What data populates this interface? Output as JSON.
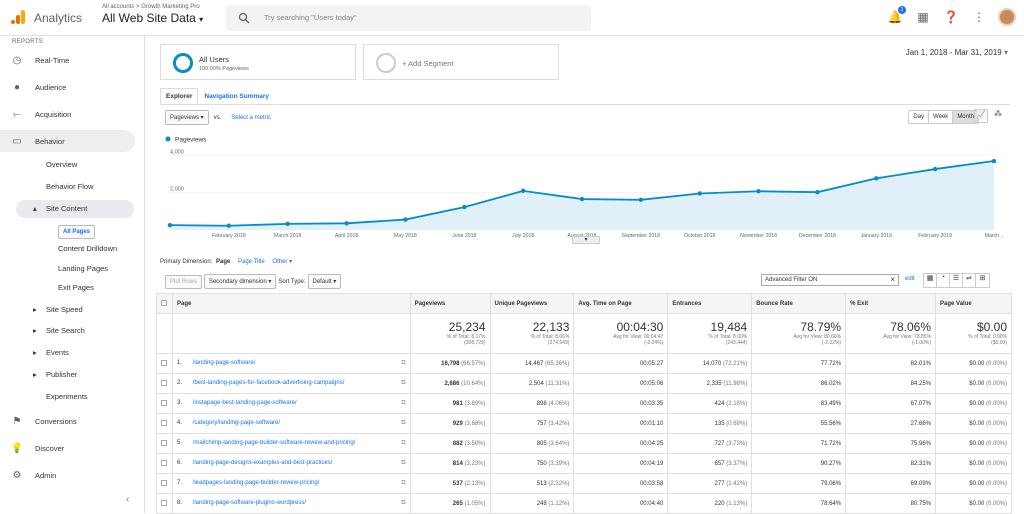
{
  "header": {
    "app_name": "Analytics",
    "breadcrumb": "All accounts > Growth Marketing Pro",
    "property": "All Web Site Data",
    "search_placeholder": "Try searching \"Users today\"",
    "notification_count": "1"
  },
  "sidebar": {
    "section_label": "REPORTS",
    "items": [
      {
        "label": "Real-Time",
        "icon": "clock-icon"
      },
      {
        "label": "Audience",
        "icon": "person-icon"
      },
      {
        "label": "Acquisition",
        "icon": "acquisition-icon"
      },
      {
        "label": "Behavior",
        "icon": "behavior-icon"
      }
    ],
    "behavior_subitems": [
      "Overview",
      "Behavior Flow"
    ],
    "site_content": {
      "label": "Site Content",
      "children": [
        "All Pages",
        "Content Drilldown",
        "Landing Pages",
        "Exit Pages"
      ]
    },
    "more_subitems": [
      "Site Speed",
      "Site Search",
      "Events",
      "Publisher"
    ],
    "experiments": "Experiments",
    "bottom_items": [
      {
        "label": "Conversions",
        "icon": "flag-icon"
      },
      {
        "label": "Discover",
        "icon": "lightbulb-icon"
      },
      {
        "label": "Admin",
        "icon": "gear-icon"
      }
    ]
  },
  "segments": {
    "all_users_label": "All Users",
    "all_users_pct": "100.00% Pageviews",
    "add_segment": "+ Add Segment"
  },
  "date_range": "Jan 1, 2018 - Mar 31, 2019",
  "tabs": [
    "Explorer",
    "Navigation Summary"
  ],
  "controls": {
    "metric": "Pageviews",
    "vs": "vs.",
    "select_metric": "Select a metric",
    "period_buttons": [
      "Day",
      "Week",
      "Month"
    ],
    "active_period": "Month"
  },
  "chart_data": {
    "type": "line",
    "series": [
      {
        "name": "Pageviews",
        "values": [
          260,
          230,
          330,
          360,
          560,
          1230,
          2100,
          1660,
          1620,
          1960,
          2080,
          2030,
          2770,
          3270,
          3700
        ]
      }
    ],
    "categories": [
      "",
      "February 2018",
      "March 2018",
      "April 2018",
      "May 2018",
      "June 2018",
      "July 2018",
      "August 2018",
      "September 2018",
      "October 2018",
      "November 2018",
      "December 2018",
      "January 2019",
      "February 2019",
      "March..."
    ],
    "y_ticks": [
      "4,000",
      "2,000"
    ],
    "ylim": [
      0,
      4400
    ],
    "color": "#058dc7",
    "fill": "#e1f0f8"
  },
  "dimension": {
    "label": "Primary Dimension:",
    "options": [
      "Page",
      "Page Title",
      "Other"
    ]
  },
  "toolbar": {
    "plot_rows": "Plot Rows",
    "secondary_dimension": "Secondary dimension",
    "sort_type_label": "Sort Type:",
    "sort_type": "Default",
    "filter": "Advanced Filter ON",
    "edit": "edit"
  },
  "table": {
    "headers": [
      "Page",
      "Pageviews",
      "Unique Pageviews",
      "Avg. Time on Page",
      "Entrances",
      "Bounce Rate",
      "% Exit",
      "Page Value"
    ],
    "totals": [
      {
        "big": "25,234",
        "small1": "% of Total: 8.17%",
        "small2": "(308,729)"
      },
      {
        "big": "22,133",
        "small1": "% of Total: 8.06%",
        "small2": "(274,549)"
      },
      {
        "big": "00:04:30",
        "small1": "Avg for View: 00:04:47",
        "small2": "(-6.24%)"
      },
      {
        "big": "19,484",
        "small1": "% of Total: 8.00%",
        "small2": "(243,444)"
      },
      {
        "big": "78.79%",
        "small1": "Avg for View: 80.66%",
        "small2": "(-2.32%)"
      },
      {
        "big": "78.06%",
        "small1": "Avg for View: 78.85%",
        "small2": "(-1.00%)"
      },
      {
        "big": "$0.00",
        "small1": "% of Total: 0.00%",
        "small2": "($0.00)"
      }
    ],
    "rows": [
      {
        "n": "1.",
        "page": "/landing-page-software/",
        "pv": "16,798",
        "pvp": "(66.57%)",
        "upv": "14,467",
        "upvp": "(65.36%)",
        "time": "00:05:27",
        "ent": "14,070",
        "entp": "(72.21%)",
        "br": "77.72%",
        "exit": "82.01%",
        "val": "$0.00",
        "valp": "(0.00%)"
      },
      {
        "n": "2.",
        "page": "/best-landing-pages-for-facebook-advertising-campaigns/",
        "pv": "2,686",
        "pvp": "(10.64%)",
        "upv": "2,504",
        "upvp": "(11.31%)",
        "time": "00:05:06",
        "ent": "2,335",
        "entp": "(11.98%)",
        "br": "86.02%",
        "exit": "84.25%",
        "val": "$0.00",
        "valp": "(0.00%)"
      },
      {
        "n": "3.",
        "page": "/instapage-best-landing-page-software/",
        "pv": "981",
        "pvp": "(3.89%)",
        "upv": "898",
        "upvp": "(4.06%)",
        "time": "00:03:35",
        "ent": "424",
        "entp": "(2.18%)",
        "br": "83.49%",
        "exit": "67.07%",
        "val": "$0.00",
        "valp": "(0.00%)"
      },
      {
        "n": "4.",
        "page": "/category/landing-page-software/",
        "pv": "929",
        "pvp": "(3.68%)",
        "upv": "757",
        "upvp": "(3.42%)",
        "time": "00:01:10",
        "ent": "135",
        "entp": "(0.69%)",
        "br": "55.56%",
        "exit": "27.66%",
        "val": "$0.00",
        "valp": "(0.00%)"
      },
      {
        "n": "5.",
        "page": "/mailchimp-landing-page-builder-software-review-and-pricing/",
        "pv": "882",
        "pvp": "(3.50%)",
        "upv": "805",
        "upvp": "(3.64%)",
        "time": "00:04:25",
        "ent": "727",
        "entp": "(3.73%)",
        "br": "71.72%",
        "exit": "75.96%",
        "val": "$0.00",
        "valp": "(0.00%)"
      },
      {
        "n": "6.",
        "page": "/landing-page-designs-examples-and-best-practices/",
        "pv": "814",
        "pvp": "(3.23%)",
        "upv": "750",
        "upvp": "(3.39%)",
        "time": "00:04:19",
        "ent": "657",
        "entp": "(3.37%)",
        "br": "90.27%",
        "exit": "82.31%",
        "val": "$0.00",
        "valp": "(0.00%)"
      },
      {
        "n": "7.",
        "page": "/leadpages-landing-page-builder-review-pricing/",
        "pv": "537",
        "pvp": "(2.13%)",
        "upv": "513",
        "upvp": "(2.32%)",
        "time": "00:03:58",
        "ent": "277",
        "entp": "(1.42%)",
        "br": "79.06%",
        "exit": "69.09%",
        "val": "$0.00",
        "valp": "(0.00%)"
      },
      {
        "n": "8.",
        "page": "/landing-page-software-plugins-wordpress/",
        "pv": "265",
        "pvp": "(1.05%)",
        "upv": "248",
        "upvp": "(1.12%)",
        "time": "00:04:40",
        "ent": "220",
        "entp": "(1.13%)",
        "br": "78.64%",
        "exit": "80.75%",
        "val": "$0.00",
        "valp": "(0.00%)"
      }
    ]
  }
}
